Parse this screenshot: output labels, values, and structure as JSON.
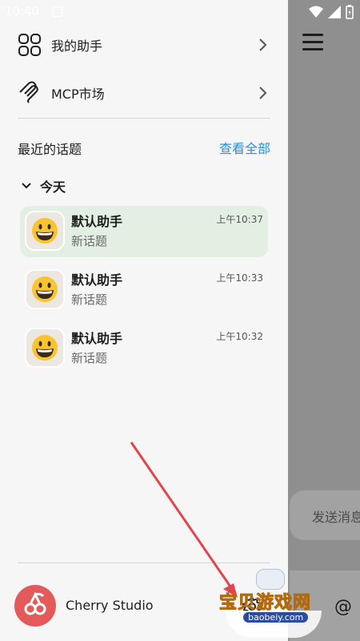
{
  "status_bar": {
    "time": "10:40"
  },
  "drawer": {
    "menu": [
      {
        "label": "我的助手",
        "icon": "grid-apps-icon"
      },
      {
        "label": "MCP市场",
        "icon": "mcp-icon"
      }
    ],
    "recent_title": "最近的话题",
    "view_all": "查看全部",
    "groups": [
      {
        "label": "今天",
        "topics": [
          {
            "name": "默认助手",
            "subtitle": "新话题",
            "time": "上午10:37",
            "active": true
          },
          {
            "name": "默认助手",
            "subtitle": "新话题",
            "time": "上午10:33",
            "active": false
          },
          {
            "name": "默认助手",
            "subtitle": "新话题",
            "time": "上午10:32",
            "active": false
          }
        ]
      }
    ],
    "app_name": "Cherry Studio"
  },
  "background": {
    "input_placeholder": "发送消息",
    "at_symbol": "@"
  },
  "watermark": {
    "text": "宝贝游戏网",
    "url": "baobeiy.com"
  },
  "colors": {
    "accent_link": "#2b8fd6",
    "active_topic_bg": "#e3efe3",
    "logo_red": "#e25a59",
    "annotation_arrow": "#e0464b"
  }
}
